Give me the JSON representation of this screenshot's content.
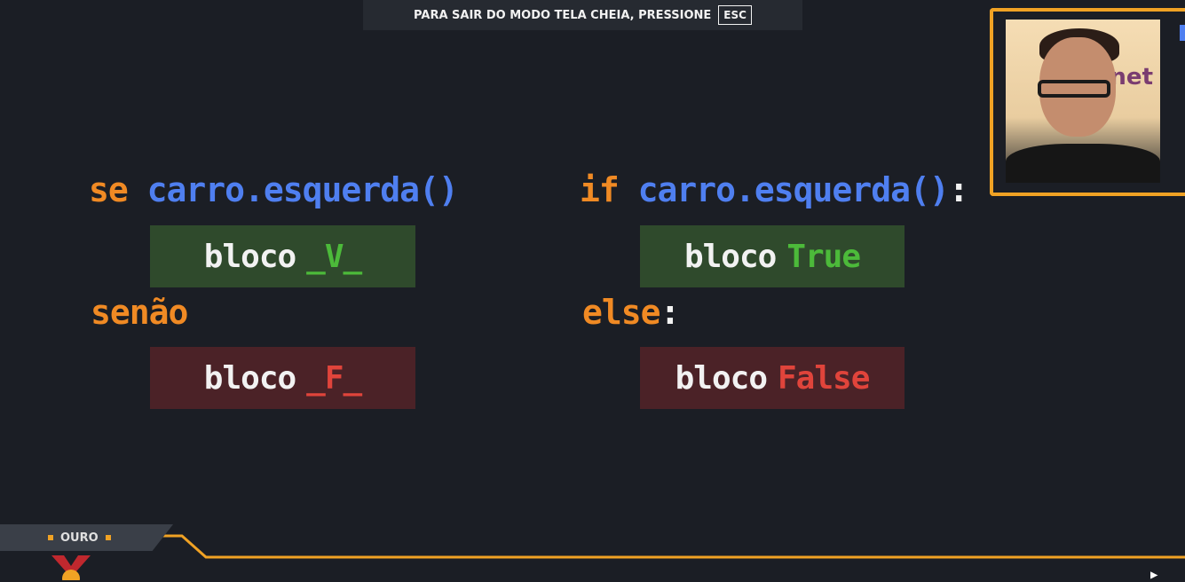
{
  "notice": {
    "text": "PARA SAIR DO MODO TELA CHEIA, PRESSIONE",
    "key": "ESC"
  },
  "code_pt": {
    "if_keyword": "se",
    "condition": "carro.esquerda()",
    "true_block": {
      "label": "bloco",
      "value": "_V_"
    },
    "else_keyword": "senão",
    "false_block": {
      "label": "bloco",
      "value": "_F_"
    }
  },
  "code_py": {
    "if_keyword": "if",
    "condition": "carro.esquerda()",
    "colon": ":",
    "true_block": {
      "label": "bloco",
      "value": "True"
    },
    "else_keyword": "else",
    "false_block": {
      "label": "bloco",
      "value": "False"
    }
  },
  "webcam": {
    "brand_text": "net"
  },
  "rank": {
    "label": "OURO"
  },
  "colors": {
    "keyword": "#f08a24",
    "function": "#4f7ff0",
    "true": "#4cba3a",
    "false": "#e0443b",
    "accent": "#f0a224"
  }
}
